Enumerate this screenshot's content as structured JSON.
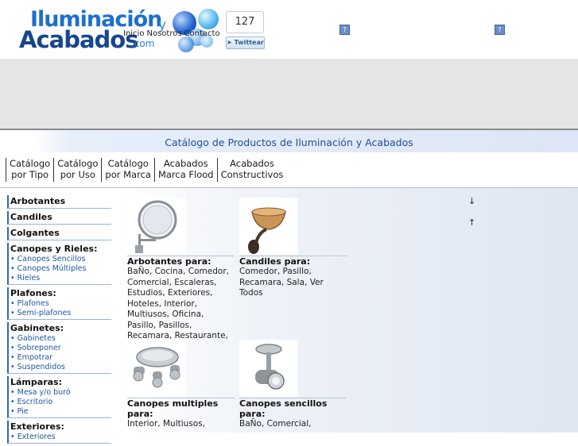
{
  "logo": {
    "line1": "Iluminación",
    "connector": "y",
    "line2": "Acabados",
    "domain": ".com"
  },
  "topnav": {
    "items": [
      "Inicio",
      "Nosotros",
      "Contacto"
    ]
  },
  "social": {
    "count": "127",
    "tweet_label": "Twittear"
  },
  "header_icons": [
    "?",
    "?"
  ],
  "page_title": "Catálogo de Productos de Iluminación y Acabados",
  "tabs": [
    {
      "line1": "Catálogo",
      "line2": "por Tipo"
    },
    {
      "line1": "Catálogo",
      "line2": "por Uso"
    },
    {
      "line1": "Catálogo",
      "line2": "por Marca"
    },
    {
      "line1": "Acabados",
      "line2": "Marca Flood"
    },
    {
      "line1": "Acabados",
      "line2": "Constructivos"
    }
  ],
  "sidebar": [
    {
      "title": "Arbotantes",
      "items": []
    },
    {
      "title": "Candiles",
      "items": []
    },
    {
      "title": "Colgantes",
      "items": []
    },
    {
      "title": "Canopes y Rieles:",
      "items": [
        "• Canopes Sencillos",
        "• Canopes Múltiples",
        "• Rieles"
      ]
    },
    {
      "title": "Plafones:",
      "items": [
        "• Plafones",
        "• Semi-plafones"
      ]
    },
    {
      "title": "Gabinetes:",
      "items": [
        "• Gabinetes",
        "• Sobreponer",
        "• Empotrar",
        "• Suspendidos"
      ]
    },
    {
      "title": "Lámparas:",
      "items": [
        "• Mesa y/o buró",
        "• Escritorio",
        "• Pie"
      ]
    },
    {
      "title": "Exteriores:",
      "items": [
        "• Exteriores"
      ]
    }
  ],
  "products": [
    {
      "title": "Arbotantes para:",
      "desc": " BaÑo, Cocina, Comedor, Comercial, Escaleras, Estudios, Exteriores, Hoteles, Interior, Multiusos, Oficina, Pasillo, Pasillos, Recamara, Restaurante, Sala, Ver"
    },
    {
      "title": "Candiles para:",
      "desc": " Comedor, Pasillo, Recamara, Sala, Ver Todos"
    },
    {
      "title": "Canopes multiples para:",
      "desc": " Interior, Multiusos,"
    },
    {
      "title": "Canopes sencillos para:",
      "desc": " BaÑo, Comercial,"
    }
  ],
  "scroll_arrows": {
    "down": "↓",
    "up": "↑"
  }
}
